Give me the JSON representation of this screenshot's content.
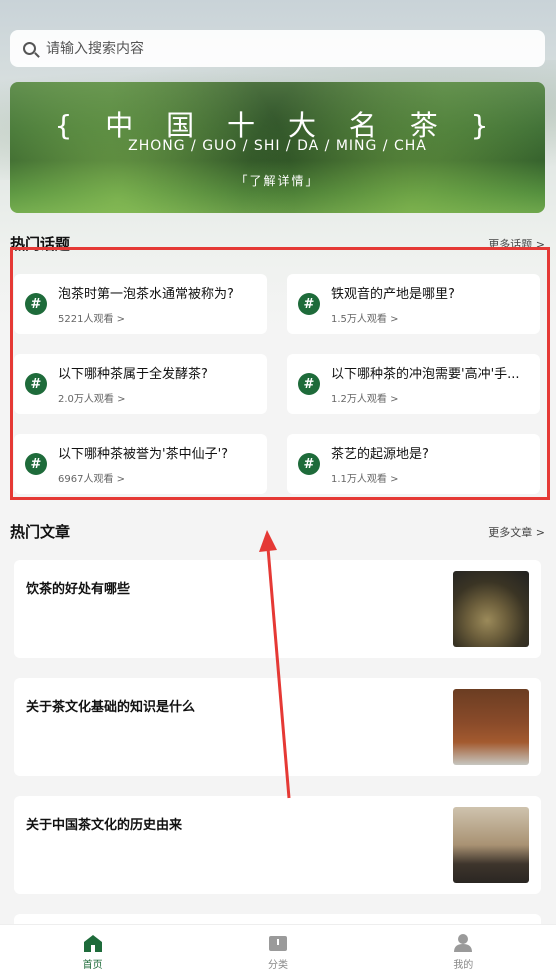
{
  "search": {
    "placeholder": "请输入搜索内容"
  },
  "banner": {
    "title": "{ 中 国 十 大 名 茶 }",
    "subtitle": "ZHONG / GUO / SHI / DA / MING / CHA",
    "button": "「了解详情」"
  },
  "hot_topics": {
    "title": "热门话题",
    "more": "更多话题 >",
    "items": [
      {
        "question": "泡茶时第一泡茶水通常被称为?",
        "views": "5221人观看 >"
      },
      {
        "question": "铁观音的产地是哪里?",
        "views": "1.5万人观看 >"
      },
      {
        "question": "以下哪种茶属于全发酵茶?",
        "views": "2.0万人观看 >"
      },
      {
        "question": "以下哪种茶的冲泡需要'高冲'手...",
        "views": "1.2万人观看 >"
      },
      {
        "question": "以下哪种茶被誉为'茶中仙子'?",
        "views": "6967人观看 >"
      },
      {
        "question": "茶艺的起源地是?",
        "views": "1.1万人观看 >"
      }
    ]
  },
  "hot_articles": {
    "title": "热门文章",
    "more": "更多文章 >",
    "items": [
      {
        "title": "饮茶的好处有哪些"
      },
      {
        "title": "关于茶文化基础的知识是什么"
      },
      {
        "title": "关于中国茶文化的历史由来"
      }
    ]
  },
  "tabbar": {
    "home": "首页",
    "category": "分类",
    "mine": "我的"
  },
  "colors": {
    "accent": "#1e6b3a",
    "highlight": "#e53935"
  }
}
